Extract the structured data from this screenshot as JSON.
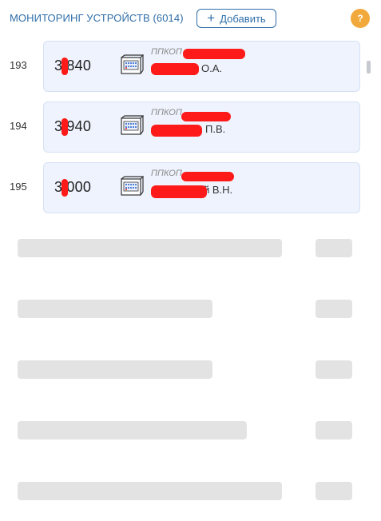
{
  "header": {
    "title": "МОНИТОРИНГ УСТРОЙСТВ (6014)",
    "add_label": "Добавить",
    "help_label": "?"
  },
  "devices": [
    {
      "index": "193",
      "number": "3 840",
      "type": "ППКОП",
      "owner": "О.А."
    },
    {
      "index": "194",
      "number": "3 940",
      "type": "ППКОП",
      "owner": "П.В."
    },
    {
      "index": "195",
      "number": "3 000",
      "type": "ППКОП",
      "owner": "й В.Н."
    }
  ],
  "icons": {
    "add": "plus-icon",
    "help": "question-icon",
    "device": "control-panel-icon"
  },
  "colors": {
    "accent": "#2f6ea8",
    "help_badge": "#f2a93b",
    "card_bg": "#eef3fd",
    "skeleton": "#e3e3e3",
    "redaction": "#ff1a1a"
  }
}
